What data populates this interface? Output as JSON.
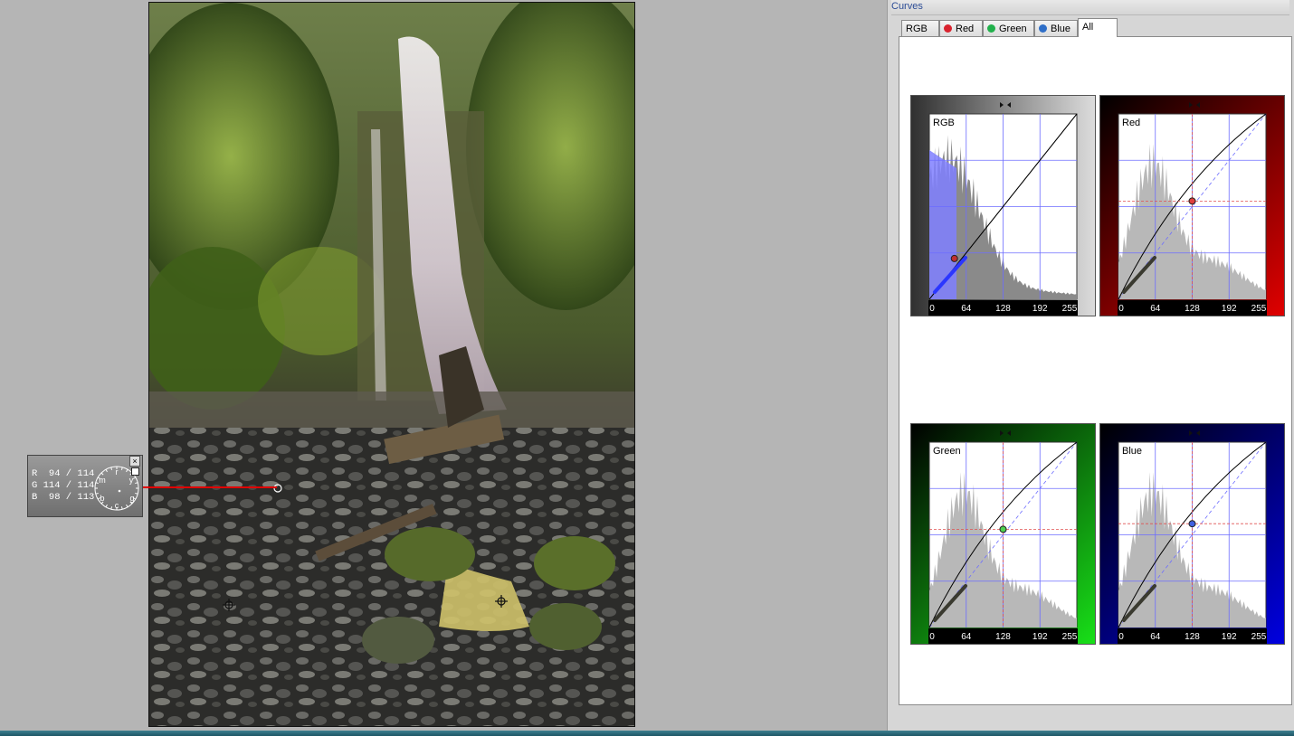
{
  "panel": {
    "title": "Curves",
    "tabs": [
      {
        "label": "RGB",
        "dot": null
      },
      {
        "label": "Red",
        "dot": "#d9232e"
      },
      {
        "label": "Green",
        "dot": "#22b14c"
      },
      {
        "label": "Blue",
        "dot": "#2f6fc8"
      },
      {
        "label": "All",
        "dot": null
      }
    ],
    "active_tab": "All"
  },
  "picker": {
    "rows": [
      "R  94 / 114",
      "G 114 / 114",
      "B  98 / 113"
    ],
    "dial_letters": [
      "r",
      "y",
      "g",
      "c",
      "b",
      "m"
    ],
    "close_glyph": "×"
  },
  "curves": [
    {
      "label": "RGB",
      "color": "#a0a0a0",
      "axis_ticks": [
        "0",
        "64",
        "128",
        "192",
        "255"
      ]
    },
    {
      "label": "Red",
      "color": "#e00000",
      "axis_ticks": [
        "0",
        "64",
        "128",
        "192",
        "255"
      ]
    },
    {
      "label": "Green",
      "color": "#18e018",
      "axis_ticks": [
        "0",
        "64",
        "128",
        "192",
        "255"
      ]
    },
    {
      "label": "Blue",
      "color": "#0000e0",
      "axis_ticks": [
        "0",
        "64",
        "128",
        "192",
        "255"
      ]
    }
  ],
  "colors": {
    "accent": "#2c4c96",
    "probe_line": "#e00000"
  }
}
